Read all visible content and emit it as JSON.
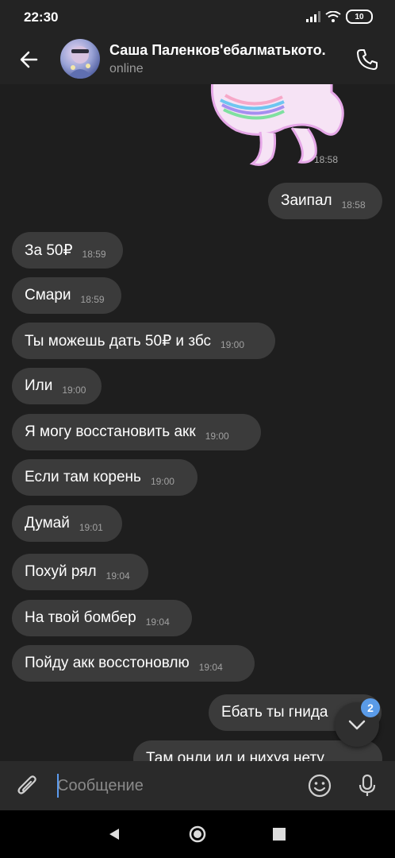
{
  "status_bar": {
    "time": "22:30",
    "battery": "10"
  },
  "header": {
    "contact_name": "Саша Паленков'ебалматькото.",
    "status": "online"
  },
  "sticker": {
    "time": "18:58"
  },
  "messages": [
    {
      "text": "Заипал",
      "time": "18:58",
      "outgoing": true
    },
    {
      "text": "За 50₽",
      "time": "18:59",
      "outgoing": false
    },
    {
      "text": "Смари",
      "time": "18:59",
      "outgoing": false
    },
    {
      "text": "Ты можешь дать 50₽ и збс",
      "time": "19:00",
      "outgoing": false
    },
    {
      "text": "Или",
      "time": "19:00",
      "outgoing": false
    },
    {
      "text": "Я могу восстановить акк",
      "time": "19:00",
      "outgoing": false
    },
    {
      "text": "Если там корень",
      "time": "19:00",
      "outgoing": false
    },
    {
      "text": "Думай",
      "time": "19:01",
      "outgoing": false
    },
    {
      "text": "Похуй рял",
      "time": "19:04",
      "outgoing": false
    },
    {
      "text": "На твой бомбер",
      "time": "19:04",
      "outgoing": false
    },
    {
      "text": "Пойду акк восстоновлю",
      "time": "19:04",
      "outgoing": false
    },
    {
      "text": "Ебать ты гнида",
      "time": "",
      "outgoing": true
    },
    {
      "text": "Там онли ид и нихуя нету",
      "time": "",
      "outgoing": true
    }
  ],
  "scroll_button": {
    "unread_count": "2"
  },
  "composer": {
    "placeholder": "Сообщение",
    "value": ""
  },
  "colors": {
    "background": "#1e1e1e",
    "bubble": "#3b3b3b",
    "accent": "#5a9be8"
  },
  "icons": [
    "back-arrow-icon",
    "phone-icon",
    "attach-icon",
    "emoji-icon",
    "mic-icon",
    "chevron-down-icon"
  ]
}
